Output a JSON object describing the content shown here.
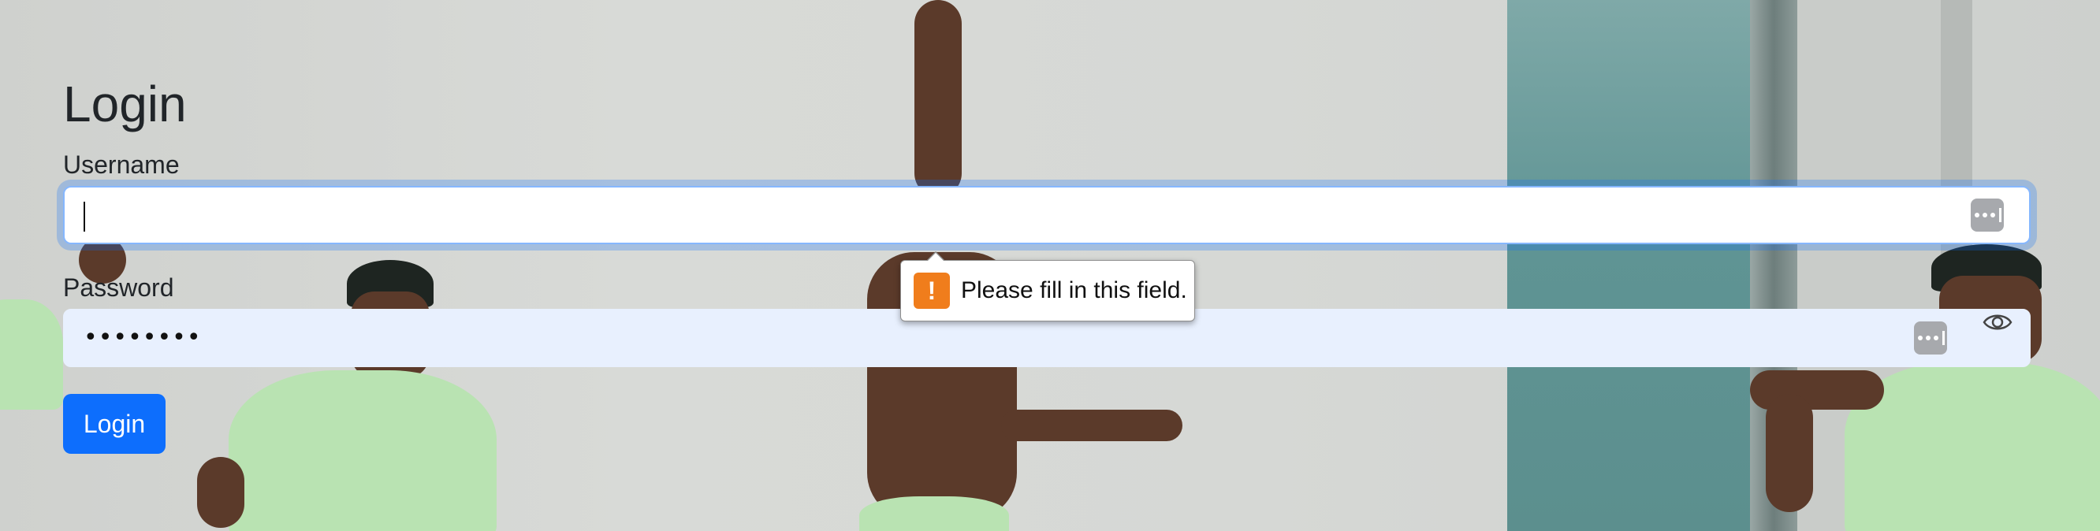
{
  "page": {
    "title": "Login"
  },
  "form": {
    "username_label": "Username",
    "username_value": "",
    "password_label": "Password",
    "password_masked": "••••••••",
    "submit_label": "Login"
  },
  "validation": {
    "message": "Please fill in this field.",
    "icon": "!"
  },
  "icons": {
    "password_manager": "password-manager-icon",
    "show_password": "eye-icon",
    "warning": "warning-icon"
  },
  "colors": {
    "primary": "#0d6efd",
    "focus_ring": "#86b7fe",
    "autofill_bg": "#e8f0fe",
    "warning": "#f07d1c",
    "text": "#212529"
  }
}
